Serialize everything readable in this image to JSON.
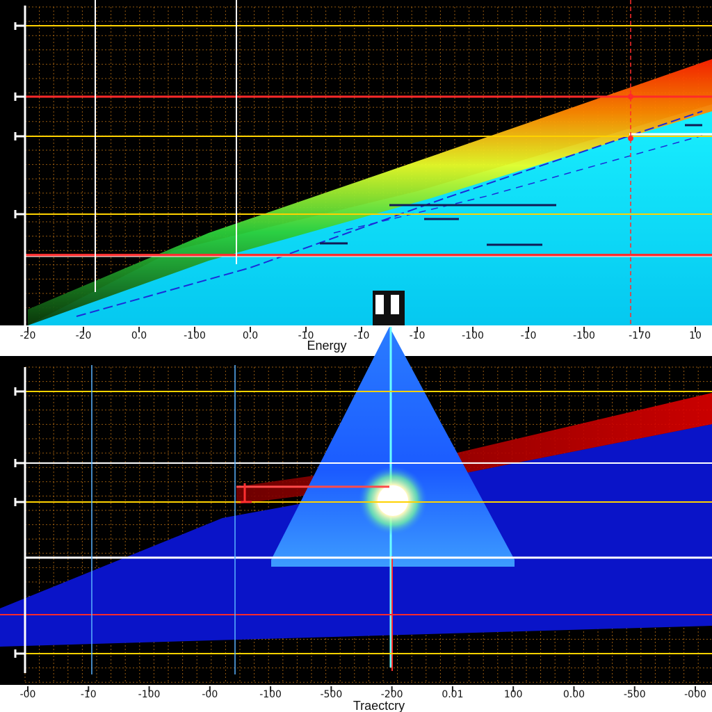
{
  "chart_data": [
    {
      "type": "area",
      "panel": "top",
      "xlabel": "Energy",
      "xtick_labels": [
        "-20",
        "-20",
        "0.0",
        "-100",
        "0.0",
        "-10",
        "-10",
        "-10",
        "-100",
        "-10",
        "-100",
        "-170",
        "10"
      ],
      "grid": true,
      "band_colors": [
        "#ffff33",
        "#33ff66",
        "#ff6a00",
        "#ff2200"
      ],
      "fill_color": "#00e5ff"
    },
    {
      "type": "area",
      "panel": "bottom",
      "xlabel": "Traectcry",
      "xtick_labels": [
        "-00",
        "-10",
        "-100",
        "-00",
        "-100",
        "-500",
        "-200",
        "0.01",
        "100",
        "0.00",
        "-500",
        "-000"
      ],
      "grid": true,
      "band_colors": [
        "#cc0000",
        "#0a14c8"
      ],
      "fill_color": "#1e78ff"
    }
  ],
  "colors": {
    "background": "#000000",
    "grid_minor": "#c87814",
    "guide_yellow": "#ffd200",
    "guide_red": "#ff2a2a",
    "axis_band": "#ffffff"
  }
}
